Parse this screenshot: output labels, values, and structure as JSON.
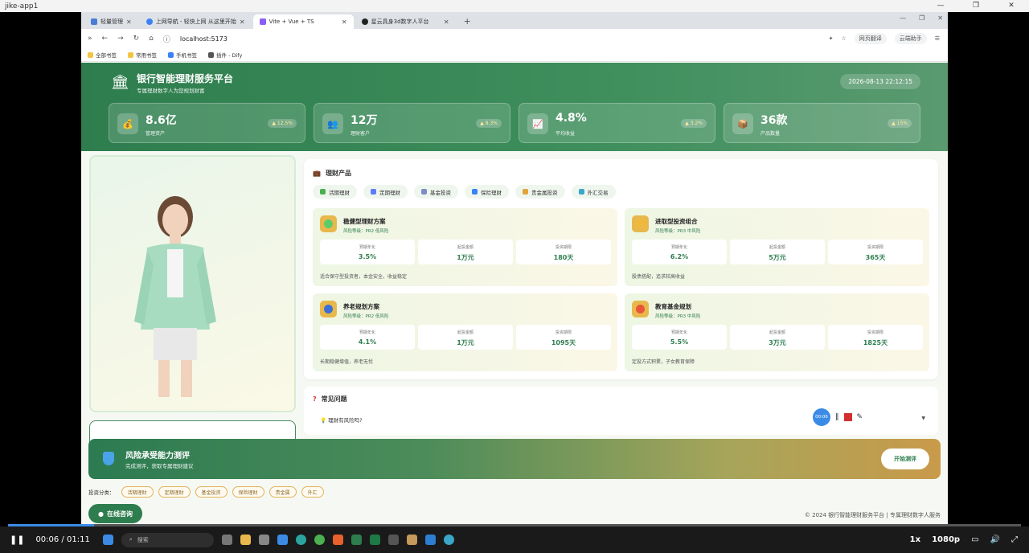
{
  "window": {
    "title": "jike-app1"
  },
  "browser": {
    "tabs": [
      {
        "label": "轻量管理"
      },
      {
        "label": "上网导航 - 轻快上网 从这里开始"
      },
      {
        "label": "Vite + Vue + TS"
      },
      {
        "label": "星云具身3d数字人平台"
      }
    ],
    "url": "localhost:5173",
    "right_pills": [
      "网页翻译",
      "云端助手"
    ],
    "bookmarks": [
      "全部书签",
      "常用书签",
      "手机书签",
      "插件 - Dify"
    ]
  },
  "header": {
    "title": "银行智能理财服务平台",
    "subtitle": "专属理财数字人为您规划财富",
    "datetime": "2026-08-13 22:12:15",
    "stats": [
      {
        "value": "8.6亿",
        "label": "管理资产",
        "trend": "▲ 12.5%"
      },
      {
        "value": "12万",
        "label": "理财客户",
        "trend": "▲ 8.3%"
      },
      {
        "value": "4.8%",
        "label": "平均收益",
        "trend": "▲ 3.2%"
      },
      {
        "value": "36款",
        "label": "产品数量",
        "trend": "▲ 15%"
      }
    ]
  },
  "products": {
    "title": "理财产品",
    "tabs": [
      {
        "label": "活期理财",
        "color": "#4caf50"
      },
      {
        "label": "定期理财",
        "color": "#5c7cfa"
      },
      {
        "label": "基金投资",
        "color": "#7b8dc8"
      },
      {
        "label": "保险理财",
        "color": "#3b82f6"
      },
      {
        "label": "贵金属投资",
        "color": "#e0a43a"
      },
      {
        "label": "外汇交易",
        "color": "#3aa6c9"
      }
    ],
    "cards": [
      {
        "name": "稳健型理财方案",
        "risk": "风险等级：PR2 低风险",
        "dot": "#5ecb6a",
        "metrics": [
          {
            "label": "预期年化",
            "value": "3.5%"
          },
          {
            "label": "起投金额",
            "value": "1万元"
          },
          {
            "label": "投资期限",
            "value": "180天"
          }
        ],
        "desc": "适合保守型投资者，本金安全，收益稳定"
      },
      {
        "name": "进取型投资组合",
        "risk": "风险等级：PR3 中风险",
        "dot": "#f1b93a",
        "metrics": [
          {
            "label": "预期年化",
            "value": "6.2%"
          },
          {
            "label": "起投金额",
            "value": "5万元"
          },
          {
            "label": "投资期限",
            "value": "365天"
          }
        ],
        "desc": "股债搭配，追求较高收益"
      },
      {
        "name": "养老规划方案",
        "risk": "风险等级：PR2 低风险",
        "dot": "#3b6fd6",
        "metrics": [
          {
            "label": "预期年化",
            "value": "4.1%"
          },
          {
            "label": "起投金额",
            "value": "1万元"
          },
          {
            "label": "投资期限",
            "value": "1095天"
          }
        ],
        "desc": "长期稳健增值，养老无忧"
      },
      {
        "name": "教育基金规划",
        "risk": "风险等级：PR3 中风险",
        "dot": "#e8553a",
        "metrics": [
          {
            "label": "预期年化",
            "value": "5.5%"
          },
          {
            "label": "起投金额",
            "value": "3万元"
          },
          {
            "label": "投资期限",
            "value": "1825天"
          }
        ],
        "desc": "定投方式积累，子女教育保障"
      }
    ]
  },
  "faq": {
    "title": "常见问题",
    "question": "理财有风险吗?"
  },
  "recorder": {
    "time": "00:06"
  },
  "banner": {
    "title": "风险承受能力测评",
    "subtitle": "完成测评，获取专属理财建议",
    "button": "开始测评"
  },
  "categories": {
    "label": "投资分类：",
    "items": [
      "活期理财",
      "定期理财",
      "基金投资",
      "保险理财",
      "贵金属",
      "外汇"
    ]
  },
  "consult": {
    "label": "在线咨询"
  },
  "footer": {
    "text": "© 2024 银行智能理财服务平台 | 专属理财数字人服务"
  },
  "player": {
    "time": "00:06 / 01:11",
    "progress": 0.085,
    "speed": "1x",
    "quality": "1080p",
    "search": "搜索"
  }
}
